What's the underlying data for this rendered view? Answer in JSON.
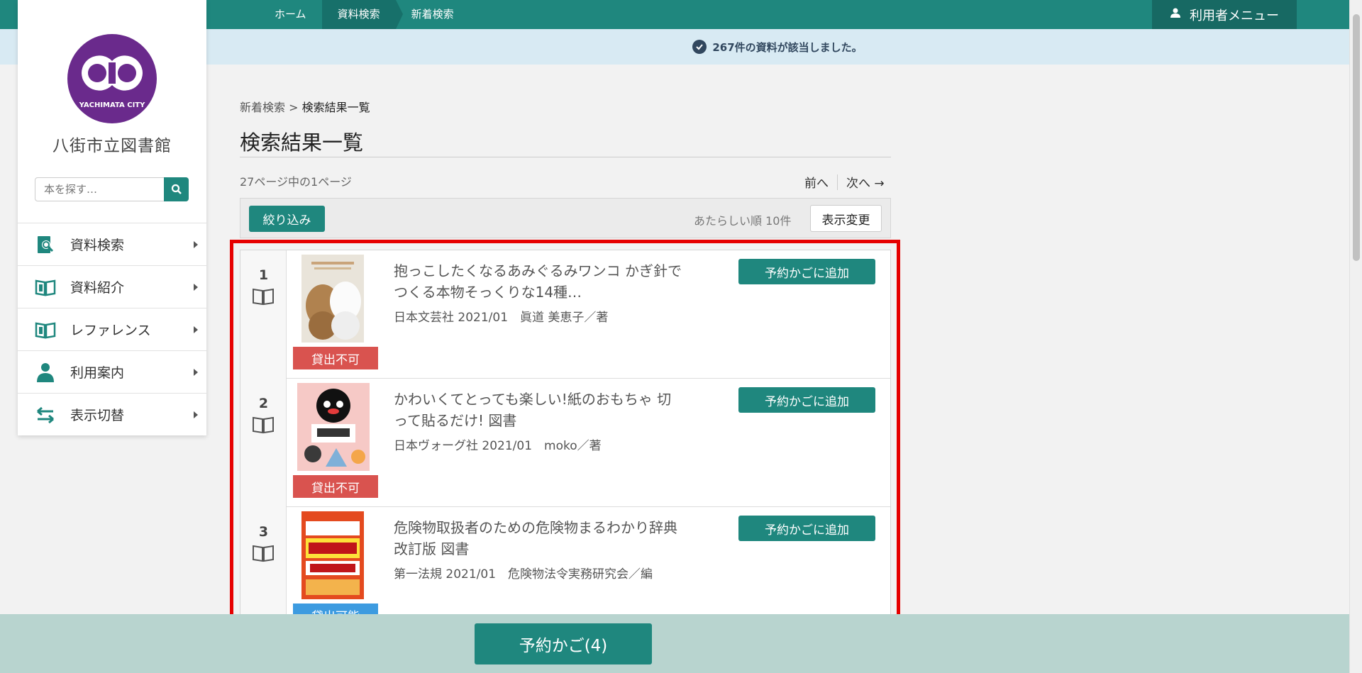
{
  "colors": {
    "accent": "#1f877e",
    "accent_dark": "#17706a",
    "danger": "#d9534f",
    "info": "#3d9be0",
    "highlight": "#e60000",
    "logo": "#6a2a8c"
  },
  "topnav": {
    "items": [
      "ホーム",
      "資料検索",
      "新着検索"
    ],
    "active_index": 1,
    "user_menu": "利用者メニュー"
  },
  "notice": {
    "text": "267件の資料が該当しました。"
  },
  "sidebar": {
    "logo_text": "YACHIMATA CITY",
    "library_name": "八街市立図書館",
    "search_placeholder": "本を探す…",
    "items": [
      {
        "label": "資料検索",
        "icon": "search-book-icon"
      },
      {
        "label": "資料紹介",
        "icon": "open-book-icon"
      },
      {
        "label": "レファレンス",
        "icon": "open-book-icon"
      },
      {
        "label": "利用案内",
        "icon": "user-icon"
      },
      {
        "label": "表示切替",
        "icon": "swap-arrows-icon"
      }
    ]
  },
  "main": {
    "breadcrumb": {
      "parent": "新着検索",
      "separator": ">",
      "current": "検索結果一覧"
    },
    "title": "検索結果一覧",
    "page_info": "27ページ中の1ページ",
    "pager": {
      "prev": "前へ",
      "next": "次へ →"
    },
    "toolbar": {
      "filter": "絞り込み",
      "sort": "あたらしい順 10件",
      "display_change": "表示変更"
    },
    "results": [
      {
        "num": "1",
        "title": "抱っこしたくなるあみぐるみワンコ かぎ針でつくる本物そっくりな14種…",
        "meta": "日本文芸社 2021/01　眞道 美恵子／著",
        "status": "貸出不可",
        "cart": "予約かごに追加"
      },
      {
        "num": "2",
        "title": "かわいくてとっても楽しい!紙のおもちゃ 切って貼るだけ! 図書",
        "meta": "日本ヴォーグ社 2021/01　moko／著",
        "status": "貸出不可",
        "cart": "予約かごに追加"
      },
      {
        "num": "3",
        "title": "危険物取扱者のための危険物まるわかり辞典 改訂版 図書",
        "meta": "第一法規 2021/01　危険物法令実務研究会／編",
        "status": "貸出可能",
        "cart": "予約かごに追加"
      }
    ]
  },
  "reserve_basket": "予約かご(4)"
}
